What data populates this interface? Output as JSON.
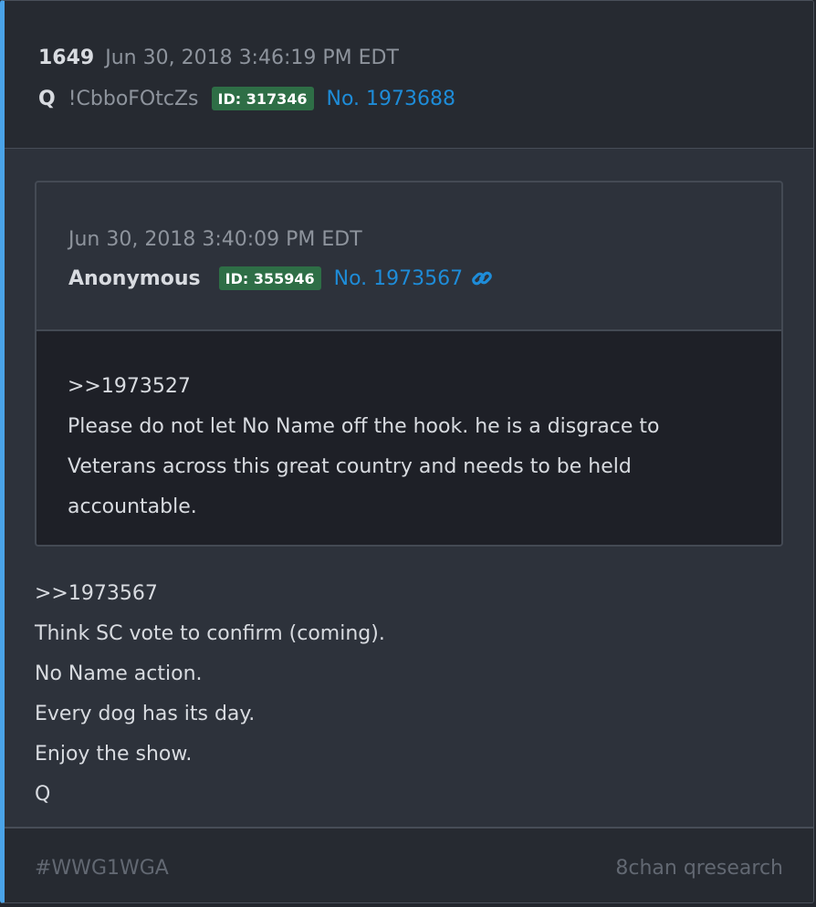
{
  "post": {
    "number": "1649",
    "timestamp": "Jun 30, 2018 3:46:19 PM EDT",
    "author": "Q",
    "tripcode": "!CbboFOtcZs",
    "id_badge": "ID: 317346",
    "post_link": "No. 1973688"
  },
  "quoted_post": {
    "timestamp": "Jun 30, 2018 3:40:09 PM EDT",
    "author": "Anonymous",
    "id_badge": "ID: 355946",
    "post_link": "No. 1973567",
    "link_icon": "link-icon",
    "lines": [
      ">>1973527",
      "Please do not let No Name off the hook. he is a disgrace to",
      "Veterans across this great country and needs to be held",
      "accountable."
    ]
  },
  "body": {
    "lines": [
      ">>1973567",
      "Think SC vote to confirm (coming).",
      "No Name action.",
      "Every dog has its day.",
      "Enjoy the show.",
      "Q"
    ]
  },
  "footer": {
    "hashtag": "#WWG1WGA",
    "source": "8chan qresearch"
  },
  "colors": {
    "accent": "#4aa3e8",
    "link": "#1e8cd8",
    "id_badge_bg": "#2e6e46",
    "card_bg": "#2d323b",
    "quote_body_bg": "#1e2027"
  }
}
